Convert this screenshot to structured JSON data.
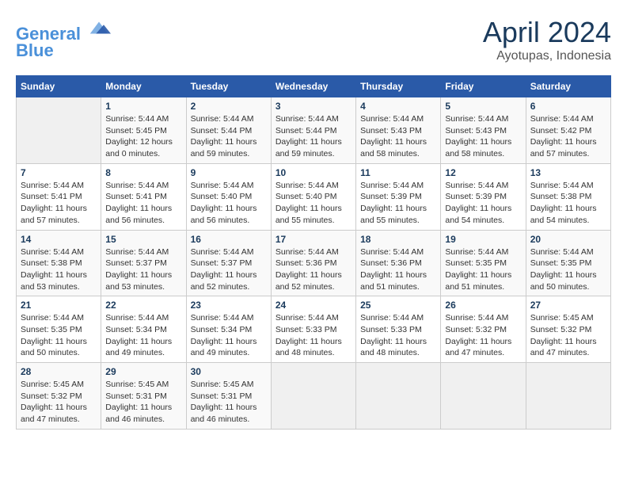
{
  "header": {
    "logo_line1": "General",
    "logo_line2": "Blue",
    "month": "April 2024",
    "location": "Ayotupas, Indonesia"
  },
  "weekdays": [
    "Sunday",
    "Monday",
    "Tuesday",
    "Wednesday",
    "Thursday",
    "Friday",
    "Saturday"
  ],
  "weeks": [
    [
      {
        "day": "",
        "info": ""
      },
      {
        "day": "1",
        "info": "Sunrise: 5:44 AM\nSunset: 5:45 PM\nDaylight: 12 hours\nand 0 minutes."
      },
      {
        "day": "2",
        "info": "Sunrise: 5:44 AM\nSunset: 5:44 PM\nDaylight: 11 hours\nand 59 minutes."
      },
      {
        "day": "3",
        "info": "Sunrise: 5:44 AM\nSunset: 5:44 PM\nDaylight: 11 hours\nand 59 minutes."
      },
      {
        "day": "4",
        "info": "Sunrise: 5:44 AM\nSunset: 5:43 PM\nDaylight: 11 hours\nand 58 minutes."
      },
      {
        "day": "5",
        "info": "Sunrise: 5:44 AM\nSunset: 5:43 PM\nDaylight: 11 hours\nand 58 minutes."
      },
      {
        "day": "6",
        "info": "Sunrise: 5:44 AM\nSunset: 5:42 PM\nDaylight: 11 hours\nand 57 minutes."
      }
    ],
    [
      {
        "day": "7",
        "info": "Sunrise: 5:44 AM\nSunset: 5:41 PM\nDaylight: 11 hours\nand 57 minutes."
      },
      {
        "day": "8",
        "info": "Sunrise: 5:44 AM\nSunset: 5:41 PM\nDaylight: 11 hours\nand 56 minutes."
      },
      {
        "day": "9",
        "info": "Sunrise: 5:44 AM\nSunset: 5:40 PM\nDaylight: 11 hours\nand 56 minutes."
      },
      {
        "day": "10",
        "info": "Sunrise: 5:44 AM\nSunset: 5:40 PM\nDaylight: 11 hours\nand 55 minutes."
      },
      {
        "day": "11",
        "info": "Sunrise: 5:44 AM\nSunset: 5:39 PM\nDaylight: 11 hours\nand 55 minutes."
      },
      {
        "day": "12",
        "info": "Sunrise: 5:44 AM\nSunset: 5:39 PM\nDaylight: 11 hours\nand 54 minutes."
      },
      {
        "day": "13",
        "info": "Sunrise: 5:44 AM\nSunset: 5:38 PM\nDaylight: 11 hours\nand 54 minutes."
      }
    ],
    [
      {
        "day": "14",
        "info": "Sunrise: 5:44 AM\nSunset: 5:38 PM\nDaylight: 11 hours\nand 53 minutes."
      },
      {
        "day": "15",
        "info": "Sunrise: 5:44 AM\nSunset: 5:37 PM\nDaylight: 11 hours\nand 53 minutes."
      },
      {
        "day": "16",
        "info": "Sunrise: 5:44 AM\nSunset: 5:37 PM\nDaylight: 11 hours\nand 52 minutes."
      },
      {
        "day": "17",
        "info": "Sunrise: 5:44 AM\nSunset: 5:36 PM\nDaylight: 11 hours\nand 52 minutes."
      },
      {
        "day": "18",
        "info": "Sunrise: 5:44 AM\nSunset: 5:36 PM\nDaylight: 11 hours\nand 51 minutes."
      },
      {
        "day": "19",
        "info": "Sunrise: 5:44 AM\nSunset: 5:35 PM\nDaylight: 11 hours\nand 51 minutes."
      },
      {
        "day": "20",
        "info": "Sunrise: 5:44 AM\nSunset: 5:35 PM\nDaylight: 11 hours\nand 50 minutes."
      }
    ],
    [
      {
        "day": "21",
        "info": "Sunrise: 5:44 AM\nSunset: 5:35 PM\nDaylight: 11 hours\nand 50 minutes."
      },
      {
        "day": "22",
        "info": "Sunrise: 5:44 AM\nSunset: 5:34 PM\nDaylight: 11 hours\nand 49 minutes."
      },
      {
        "day": "23",
        "info": "Sunrise: 5:44 AM\nSunset: 5:34 PM\nDaylight: 11 hours\nand 49 minutes."
      },
      {
        "day": "24",
        "info": "Sunrise: 5:44 AM\nSunset: 5:33 PM\nDaylight: 11 hours\nand 48 minutes."
      },
      {
        "day": "25",
        "info": "Sunrise: 5:44 AM\nSunset: 5:33 PM\nDaylight: 11 hours\nand 48 minutes."
      },
      {
        "day": "26",
        "info": "Sunrise: 5:44 AM\nSunset: 5:32 PM\nDaylight: 11 hours\nand 47 minutes."
      },
      {
        "day": "27",
        "info": "Sunrise: 5:45 AM\nSunset: 5:32 PM\nDaylight: 11 hours\nand 47 minutes."
      }
    ],
    [
      {
        "day": "28",
        "info": "Sunrise: 5:45 AM\nSunset: 5:32 PM\nDaylight: 11 hours\nand 47 minutes."
      },
      {
        "day": "29",
        "info": "Sunrise: 5:45 AM\nSunset: 5:31 PM\nDaylight: 11 hours\nand 46 minutes."
      },
      {
        "day": "30",
        "info": "Sunrise: 5:45 AM\nSunset: 5:31 PM\nDaylight: 11 hours\nand 46 minutes."
      },
      {
        "day": "",
        "info": ""
      },
      {
        "day": "",
        "info": ""
      },
      {
        "day": "",
        "info": ""
      },
      {
        "day": "",
        "info": ""
      }
    ]
  ]
}
